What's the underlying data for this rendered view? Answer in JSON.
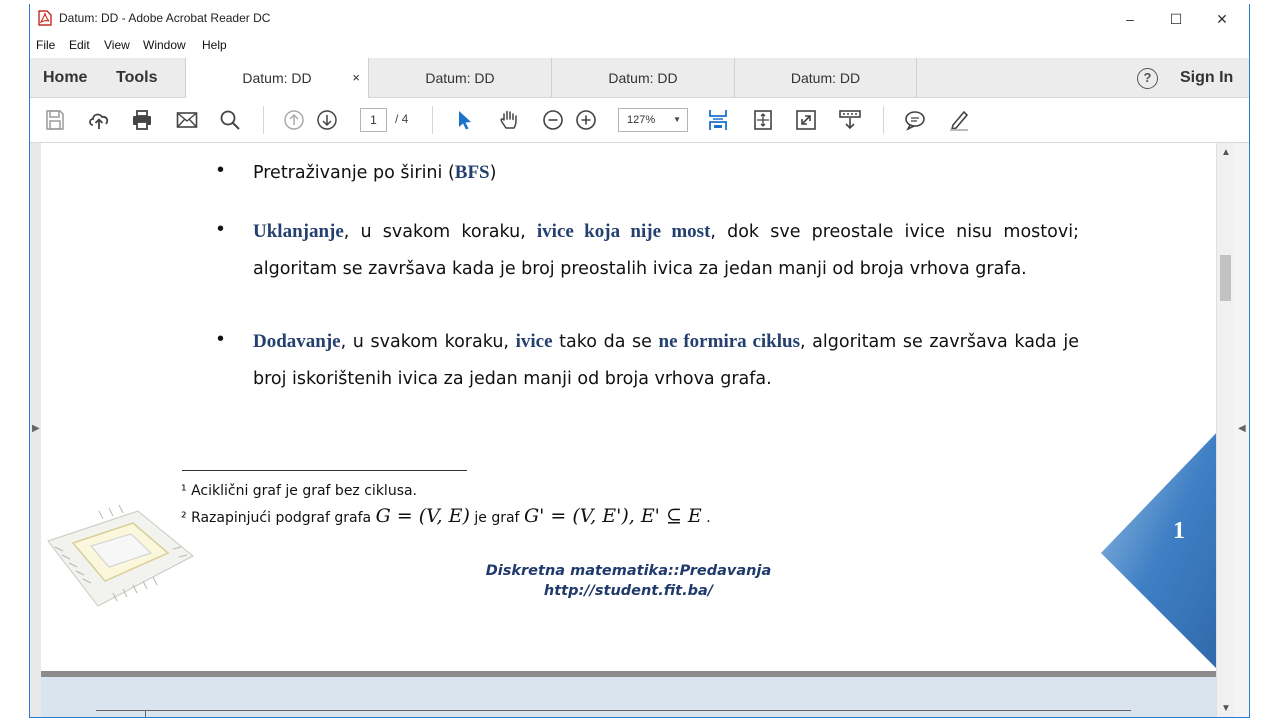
{
  "window": {
    "title": "Datum: DD - Adobe Acrobat Reader DC",
    "minimize": "–",
    "maximize": "☐",
    "close": "✕"
  },
  "menu": [
    "File",
    "Edit",
    "View",
    "Window",
    "Help"
  ],
  "nav": {
    "home": "Home",
    "tools": "Tools",
    "help": "?",
    "sign_in": "Sign In"
  },
  "tabs": [
    {
      "label": "Datum: DD",
      "close": "×"
    },
    {
      "label": "Datum: DD"
    },
    {
      "label": "Datum: DD"
    },
    {
      "label": "Datum: DD"
    }
  ],
  "toolbar": {
    "page_current": "1",
    "page_total": "/ 4",
    "zoom": "127%"
  },
  "document": {
    "bullet1": {
      "pre": "Pretraživanje po širini (",
      "kw": "BFS",
      "post": ")"
    },
    "bullet2": {
      "kw1": "Uklanjanje",
      "t1": ", u svakom koraku, ",
      "kw2": "ivice koja nije most",
      "t2": ", dok sve preostale ivice nisu mostovi; algoritam se završava kada je broj preostalih ivica za jedan manji od broja vrhova grafa."
    },
    "bullet3": {
      "kw1": "Dodavanje",
      "t1": ", u svakom koraku, ",
      "kw2": "ivice",
      "t2": " tako da se ",
      "kw3": "ne formira ciklus",
      "t3": ", algoritam se završava kada je broj iskorištenih ivica za jedan manji od broja vrhova grafa."
    },
    "footnote1": "¹ Aciklični graf je graf bez ciklusa.",
    "footnote2_pre": "² Razapinjući podgraf grafa ",
    "footnote2_m1": "G = (V, E)",
    "footnote2_mid": " je graf ",
    "footnote2_m2": "G' = (V, E'), E' ⊆ E",
    "footnote2_end": " .",
    "footer_title": "Diskretna matematika::Predavanja",
    "footer_url": "http://student.fit.ba/",
    "page_number": "1"
  },
  "colors": {
    "keyword": "#23406e",
    "footer": "#1f3a6b",
    "accent_blue": "#1a73c9"
  }
}
